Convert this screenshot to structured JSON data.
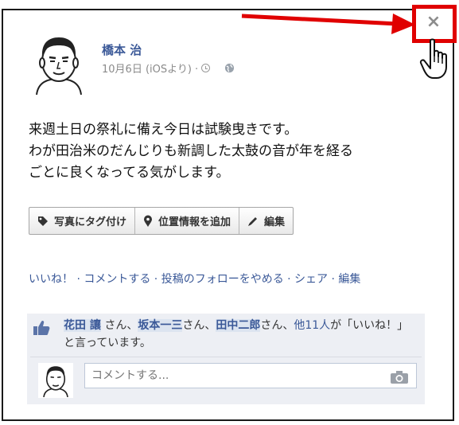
{
  "post": {
    "author": "橋本 治",
    "date": "10月6日 (iOSより) ·",
    "text": "来週土日の祭礼に備え今日は試験曳きです。\nわが田治米のだんじりも新調した太鼓の音が年を経る\nごとに良くなってる気がします。"
  },
  "toolbar": {
    "tag_label": "写真にタグ付け",
    "location_label": "位置情報を追加",
    "edit_label": "編集"
  },
  "actions": {
    "text": "いいね！ · コメントする · 投稿のフォローをやめる · シェア · 編集"
  },
  "likes": {
    "name1": "花田 讓",
    "sep1": " さん、",
    "name2": "坂本一三",
    "sep2": "さん、",
    "name3": "田中二郎",
    "sep3": "さん、",
    "others": "他11人",
    "tail": "が「いいね！」と言っています。"
  },
  "comment": {
    "placeholder": "コメントする..."
  },
  "close_symbol": "×",
  "colors": {
    "link": "#3b5998",
    "highlight": "#e00000",
    "like_bg": "#edeff4"
  },
  "icons": [
    "tag-icon",
    "pin-icon",
    "pencil-icon",
    "clock-icon",
    "globe-icon",
    "thumbs-up-icon",
    "camera-icon",
    "close-icon",
    "hand-cursor-icon"
  ]
}
